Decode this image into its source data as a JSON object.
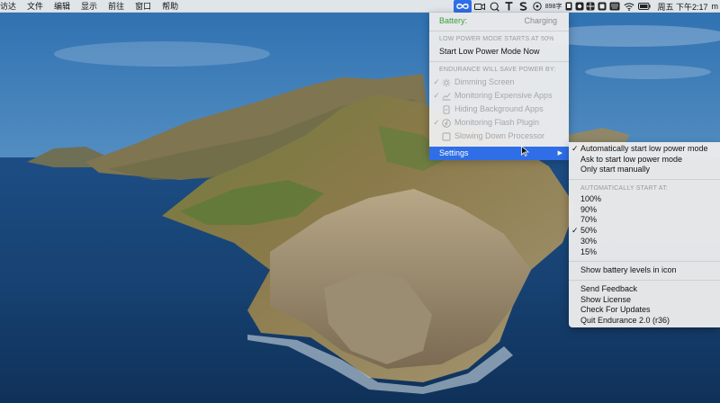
{
  "menubar": {
    "items": [
      "访达",
      "文件",
      "编辑",
      "显示",
      "前往",
      "窗口",
      "帮助"
    ],
    "status_icons": [
      "endurance-infinity-icon",
      "video-camera-icon",
      "speech-bubble-icon",
      "typora-t-icon",
      "s-app-icon",
      "disk-icon"
    ],
    "network_speed": "898字",
    "clock": "周五 下午2:17",
    "user": "m"
  },
  "endurance_menu": {
    "battery_label": "Battery:",
    "battery_status": "Charging",
    "low_power_header": "LOW POWER MODE STARTS AT 50%",
    "start_low_power": "Start Low Power Mode Now",
    "save_power_header": "ENDURANCE WILL SAVE POWER BY:",
    "options": [
      {
        "label": "Dimming Screen",
        "checked": true,
        "icon": "sun-icon"
      },
      {
        "label": "Monitoring Expensive Apps",
        "checked": true,
        "icon": "graph-icon"
      },
      {
        "label": "Hiding Background Apps",
        "checked": false,
        "icon": "app-hide-icon"
      },
      {
        "label": "Monitoring Flash Plugin",
        "checked": true,
        "icon": "flash-icon"
      },
      {
        "label": "Slowing Down Processor",
        "checked": false,
        "icon": "processor-icon"
      }
    ],
    "settings_label": "Settings"
  },
  "settings_submenu": {
    "start_modes": [
      {
        "label": "Automatically start low power mode",
        "checked": true
      },
      {
        "label": "Ask to start low power mode",
        "checked": false
      },
      {
        "label": "Only start manually",
        "checked": false
      }
    ],
    "auto_start_header": "AUTOMATICALLY START AT:",
    "levels": [
      {
        "label": "100%",
        "checked": false
      },
      {
        "label": "90%",
        "checked": false
      },
      {
        "label": "70%",
        "checked": false
      },
      {
        "label": "50%",
        "checked": true
      },
      {
        "label": "30%",
        "checked": false
      },
      {
        "label": "15%",
        "checked": false
      }
    ],
    "show_battery_levels": "Show battery levels in icon",
    "send_feedback": "Send Feedback",
    "show_license": "Show License",
    "check_updates": "Check For Updates",
    "quit": "Quit Endurance 2.0 (r36)",
    "check_mark": "✓"
  },
  "colors": {
    "highlight": "#2f6ee6",
    "battery_green": "#3aa039",
    "disabled_text": "#a6a6a6"
  }
}
